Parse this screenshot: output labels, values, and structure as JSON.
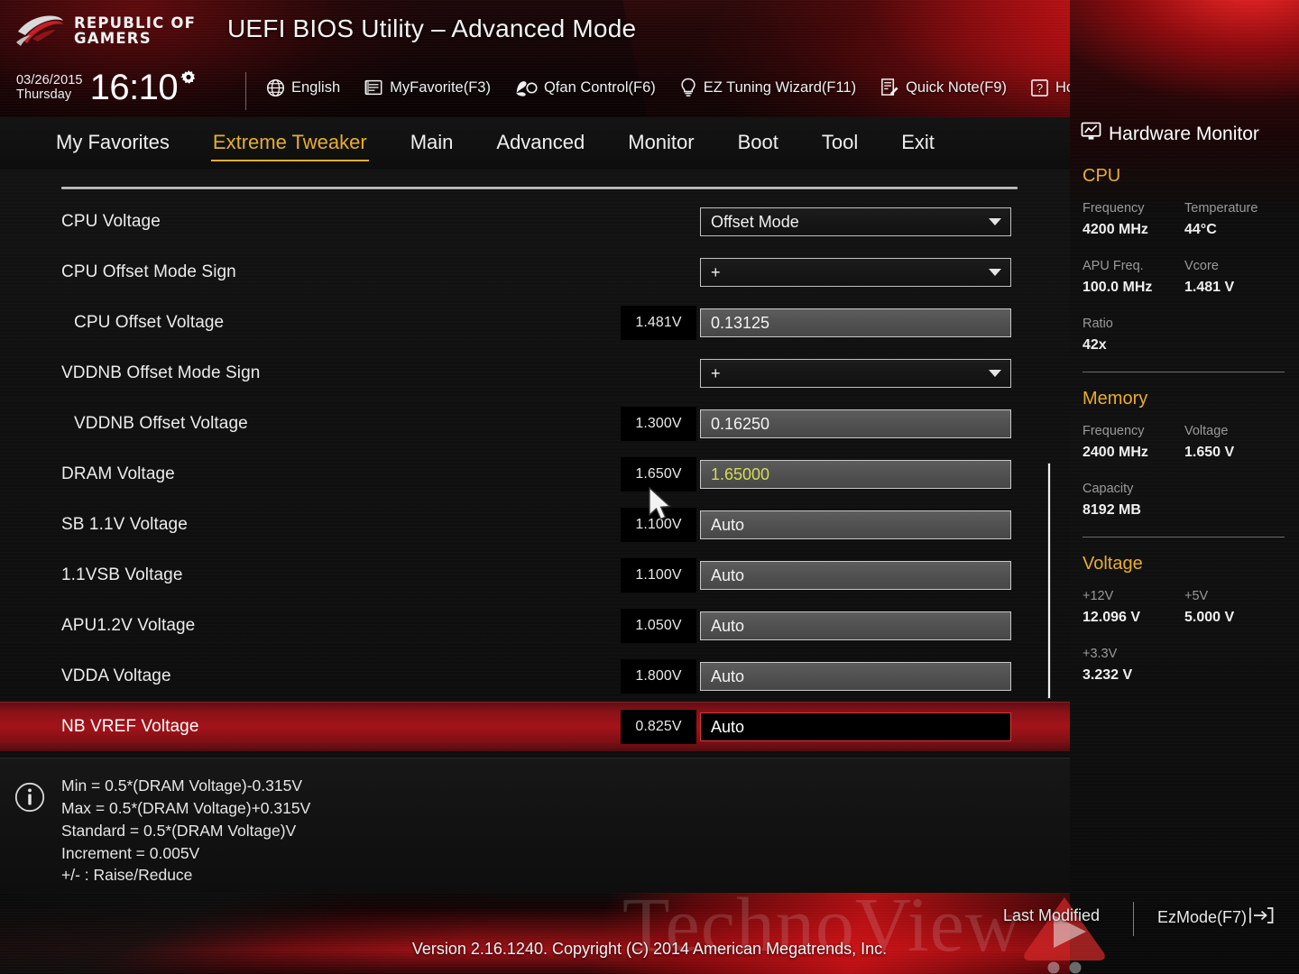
{
  "header": {
    "brand_line1": "REPUBLIC OF",
    "brand_line2": "GAMERS",
    "title": "UEFI BIOS Utility – Advanced Mode",
    "date": "03/26/2015",
    "weekday": "Thursday",
    "time": "16:10",
    "gear_icon": "gear-icon",
    "tools": [
      {
        "label": "English",
        "icon": "globe-icon"
      },
      {
        "label": "MyFavorite(F3)",
        "icon": "favorites-list-icon"
      },
      {
        "label": "Qfan Control(F6)",
        "icon": "fan-icon"
      },
      {
        "label": "EZ Tuning Wizard(F11)",
        "icon": "lightbulb-icon"
      },
      {
        "label": "Quick Note(F9)",
        "icon": "note-pencil-icon"
      },
      {
        "label": "Hot Keys",
        "icon": "question-box-icon"
      }
    ]
  },
  "nav": {
    "items": [
      {
        "label": "My Favorites",
        "active": false
      },
      {
        "label": "Extreme Tweaker",
        "active": true
      },
      {
        "label": "Main",
        "active": false
      },
      {
        "label": "Advanced",
        "active": false
      },
      {
        "label": "Monitor",
        "active": false
      },
      {
        "label": "Boot",
        "active": false
      },
      {
        "label": "Tool",
        "active": false
      },
      {
        "label": "Exit",
        "active": false
      }
    ],
    "active_color": "#e8ae2b"
  },
  "settings": {
    "rows": [
      {
        "label": "CPU Voltage",
        "indent": false,
        "type": "dropdown",
        "value": "Offset Mode",
        "badge": null,
        "selected": false,
        "highlight": false
      },
      {
        "label": "CPU Offset Mode Sign",
        "indent": false,
        "type": "dropdown",
        "value": "+",
        "badge": null,
        "selected": false,
        "highlight": false
      },
      {
        "label": "CPU Offset Voltage",
        "indent": true,
        "type": "field",
        "value": "0.13125",
        "badge": "1.481V",
        "selected": false,
        "highlight": false
      },
      {
        "label": "VDDNB Offset Mode Sign",
        "indent": false,
        "type": "dropdown",
        "value": "+",
        "badge": null,
        "selected": false,
        "highlight": false
      },
      {
        "label": "VDDNB Offset Voltage",
        "indent": true,
        "type": "field",
        "value": "0.16250",
        "badge": "1.300V",
        "selected": false,
        "highlight": false
      },
      {
        "label": "DRAM Voltage",
        "indent": false,
        "type": "field",
        "value": "1.65000",
        "badge": "1.650V",
        "selected": false,
        "highlight": true
      },
      {
        "label": "SB 1.1V Voltage",
        "indent": false,
        "type": "field",
        "value": "Auto",
        "badge": "1.100V",
        "selected": false,
        "highlight": false
      },
      {
        "label": "1.1VSB Voltage",
        "indent": false,
        "type": "field",
        "value": "Auto",
        "badge": "1.100V",
        "selected": false,
        "highlight": false
      },
      {
        "label": "APU1.2V Voltage",
        "indent": false,
        "type": "field",
        "value": "Auto",
        "badge": "1.050V",
        "selected": false,
        "highlight": false
      },
      {
        "label": "VDDA Voltage",
        "indent": false,
        "type": "field",
        "value": "Auto",
        "badge": "1.800V",
        "selected": false,
        "highlight": false
      },
      {
        "label": "NB VREF Voltage",
        "indent": false,
        "type": "field",
        "value": "Auto",
        "badge": "0.825V",
        "selected": true,
        "highlight": false
      }
    ],
    "highlight_value_color": "#d6dd52",
    "selected_row_color": "#a31319"
  },
  "help": {
    "icon": "info-icon",
    "lines": [
      "Min = 0.5*(DRAM Voltage)-0.315V",
      "Max = 0.5*(DRAM Voltage)+0.315V",
      "Standard = 0.5*(DRAM Voltage)V",
      "Increment = 0.005V",
      "+/- : Raise/Reduce"
    ]
  },
  "hardware_monitor": {
    "title": "Hardware Monitor",
    "title_icon": "monitor-chart-icon",
    "sections": [
      {
        "name": "CPU",
        "pairs": [
          [
            {
              "key": "Frequency",
              "value": "4200 MHz"
            },
            {
              "key": "Temperature",
              "value": "44°C"
            }
          ],
          [
            {
              "key": "APU Freq.",
              "value": "100.0 MHz"
            },
            {
              "key": "Vcore",
              "value": "1.481 V"
            }
          ],
          [
            {
              "key": "Ratio",
              "value": "42x"
            }
          ]
        ]
      },
      {
        "name": "Memory",
        "pairs": [
          [
            {
              "key": "Frequency",
              "value": "2400 MHz"
            },
            {
              "key": "Voltage",
              "value": "1.650 V"
            }
          ],
          [
            {
              "key": "Capacity",
              "value": "8192 MB"
            }
          ]
        ]
      },
      {
        "name": "Voltage",
        "pairs": [
          [
            {
              "key": "+12V",
              "value": "12.096 V"
            },
            {
              "key": "+5V",
              "value": "5.000 V"
            }
          ],
          [
            {
              "key": "+3.3V",
              "value": "3.232 V"
            }
          ]
        ]
      }
    ],
    "section_color": "#e8ae2b"
  },
  "footer": {
    "version": "Version 2.16.1240. Copyright (C) 2014 American Megatrends, Inc.",
    "last_modified": "Last Modified",
    "ezmode": "EzMode(F7)",
    "ezmode_icon": "arrow-into-bracket-icon",
    "watermark": "TechnoView"
  }
}
